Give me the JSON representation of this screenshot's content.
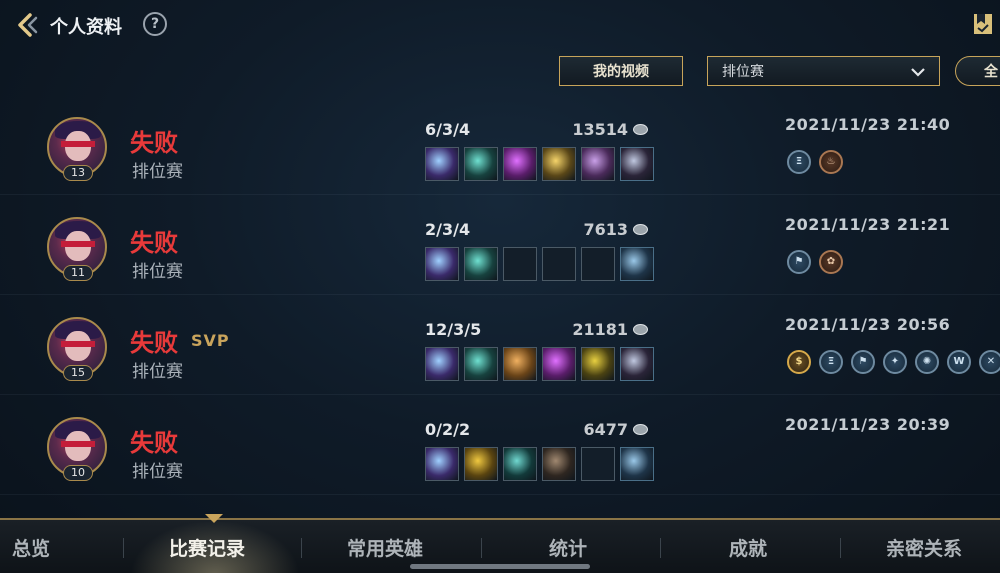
{
  "header": {
    "title": "个人资料",
    "help_icon": "question-icon",
    "back_icon": "back-arrow-icon",
    "bookmark_icon": "bookmark-icon"
  },
  "filters": {
    "video_button": "我的视频",
    "mode_select": "排位赛",
    "all_button": "全"
  },
  "matches": [
    {
      "level": "13",
      "result": "失败",
      "svp": "",
      "mode": "排位赛",
      "kda": "6/3/4",
      "gold": "13514",
      "datetime": "2021/11/23 21:40",
      "badges": [
        {
          "type": "silver",
          "glyph": "Ξ"
        },
        {
          "type": "bronze",
          "glyph": "♨"
        }
      ]
    },
    {
      "level": "11",
      "result": "失败",
      "svp": "",
      "mode": "排位赛",
      "kda": "2/3/4",
      "gold": "7613",
      "datetime": "2021/11/23 21:21",
      "badges": [
        {
          "type": "silver",
          "glyph": "⚑"
        },
        {
          "type": "bronze",
          "glyph": "✿"
        }
      ]
    },
    {
      "level": "15",
      "result": "失败",
      "svp": "SVP",
      "mode": "排位赛",
      "kda": "12/3/5",
      "gold": "21181",
      "datetime": "2021/11/23 20:56",
      "badges": [
        {
          "type": "gold",
          "glyph": "$"
        },
        {
          "type": "silver",
          "glyph": "Ξ"
        },
        {
          "type": "silver",
          "glyph": "⚑"
        },
        {
          "type": "silver",
          "glyph": "✦"
        },
        {
          "type": "silver",
          "glyph": "✺"
        },
        {
          "type": "silver",
          "glyph": "W"
        },
        {
          "type": "silver",
          "glyph": "✕"
        }
      ]
    },
    {
      "level": "10",
      "result": "失败",
      "svp": "",
      "mode": "排位赛",
      "kda": "0/2/2",
      "gold": "6477",
      "datetime": "2021/11/23 20:39",
      "badges": []
    }
  ],
  "bottom_nav": {
    "tabs": [
      "总览",
      "比赛记录",
      "常用英雄",
      "统计",
      "成就",
      "亲密关系"
    ],
    "active_index": 1
  },
  "colors": {
    "defeat": "#e83a3a",
    "svp": "#c9a45c",
    "accent_gold": "#c7a45a",
    "background": "#0f1b28"
  }
}
